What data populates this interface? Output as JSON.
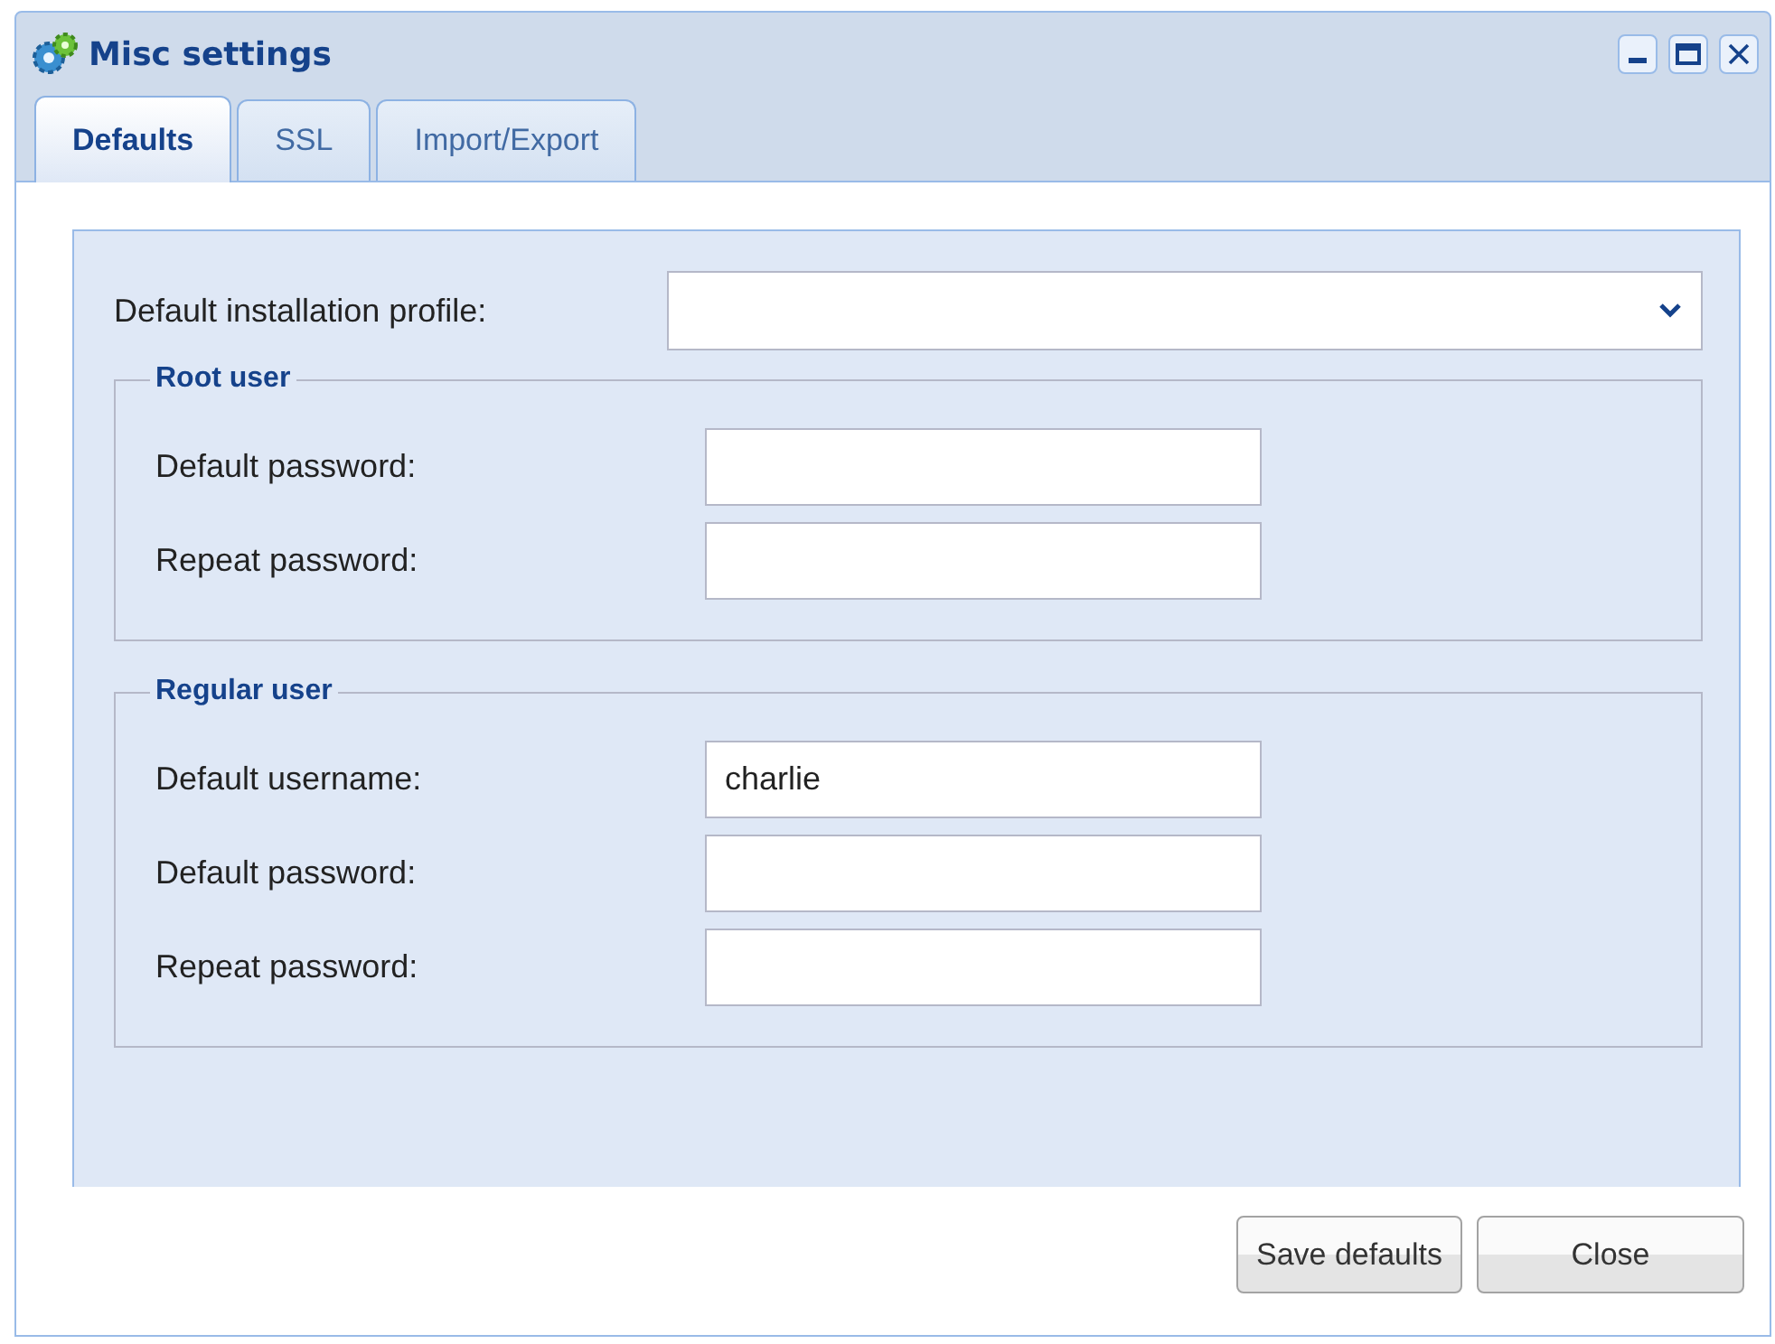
{
  "window": {
    "title": "Misc settings"
  },
  "tabs": [
    {
      "label": "Defaults",
      "selected": true
    },
    {
      "label": "SSL",
      "selected": false
    },
    {
      "label": "Import/Export",
      "selected": false
    }
  ],
  "profile": {
    "label": "Default installation profile:"
  },
  "groups": [
    {
      "legend": "Root user",
      "fields": [
        {
          "label": "Default password:",
          "kind": "password"
        },
        {
          "label": "Repeat password:",
          "kind": "password"
        }
      ]
    },
    {
      "legend": "Regular user",
      "fields": [
        {
          "label": "Default username:",
          "kind": "text",
          "value": "charlie"
        },
        {
          "label": "Default password:",
          "kind": "password"
        },
        {
          "label": "Repeat password:",
          "kind": "password"
        }
      ]
    }
  ],
  "buttons": [
    "Save defaults",
    "Close"
  ]
}
